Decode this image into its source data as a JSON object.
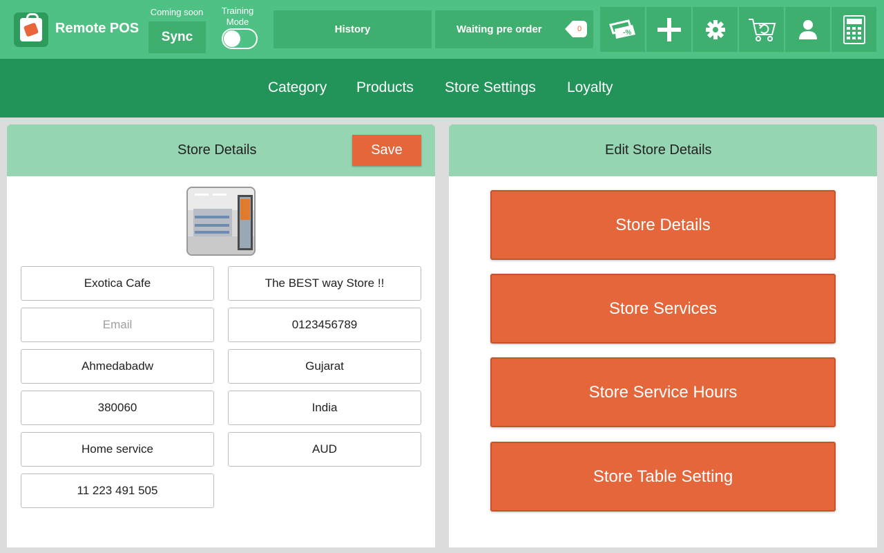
{
  "header": {
    "app_title": "Remote POS",
    "coming_soon": "Coming soon",
    "sync_label": "Sync",
    "training_mode_label": "Training\nMode",
    "training_mode_on": false,
    "history_label": "History",
    "waiting_label": "Waiting pre order",
    "waiting_count": "0",
    "tools": [
      "discount-icon",
      "add-icon",
      "settings-icon",
      "cart-refresh-icon",
      "user-icon",
      "calculator-icon"
    ]
  },
  "nav": {
    "items": [
      "Category",
      "Products",
      "Store Settings",
      "Loyalty"
    ]
  },
  "left_panel": {
    "title": "Store Details",
    "save_label": "Save",
    "fields": {
      "store_name": "Exotica Cafe",
      "tagline": "The BEST way Store !!",
      "email_placeholder": "Email",
      "phone": "0123456789",
      "city": "Ahmedabadw",
      "state": "Gujarat",
      "zip": "380060",
      "country": "India",
      "service": "Home service",
      "currency": "AUD",
      "abn": "11 223 491 505"
    }
  },
  "right_panel": {
    "title": "Edit Store Details",
    "buttons": [
      "Store Details",
      "Store Services",
      "Store Service Hours",
      "Store Table Setting"
    ]
  },
  "colors": {
    "header_green": "#4fc184",
    "nav_green": "#22945a",
    "panel_head": "#95d5b2",
    "accent_orange": "#e4663a"
  }
}
